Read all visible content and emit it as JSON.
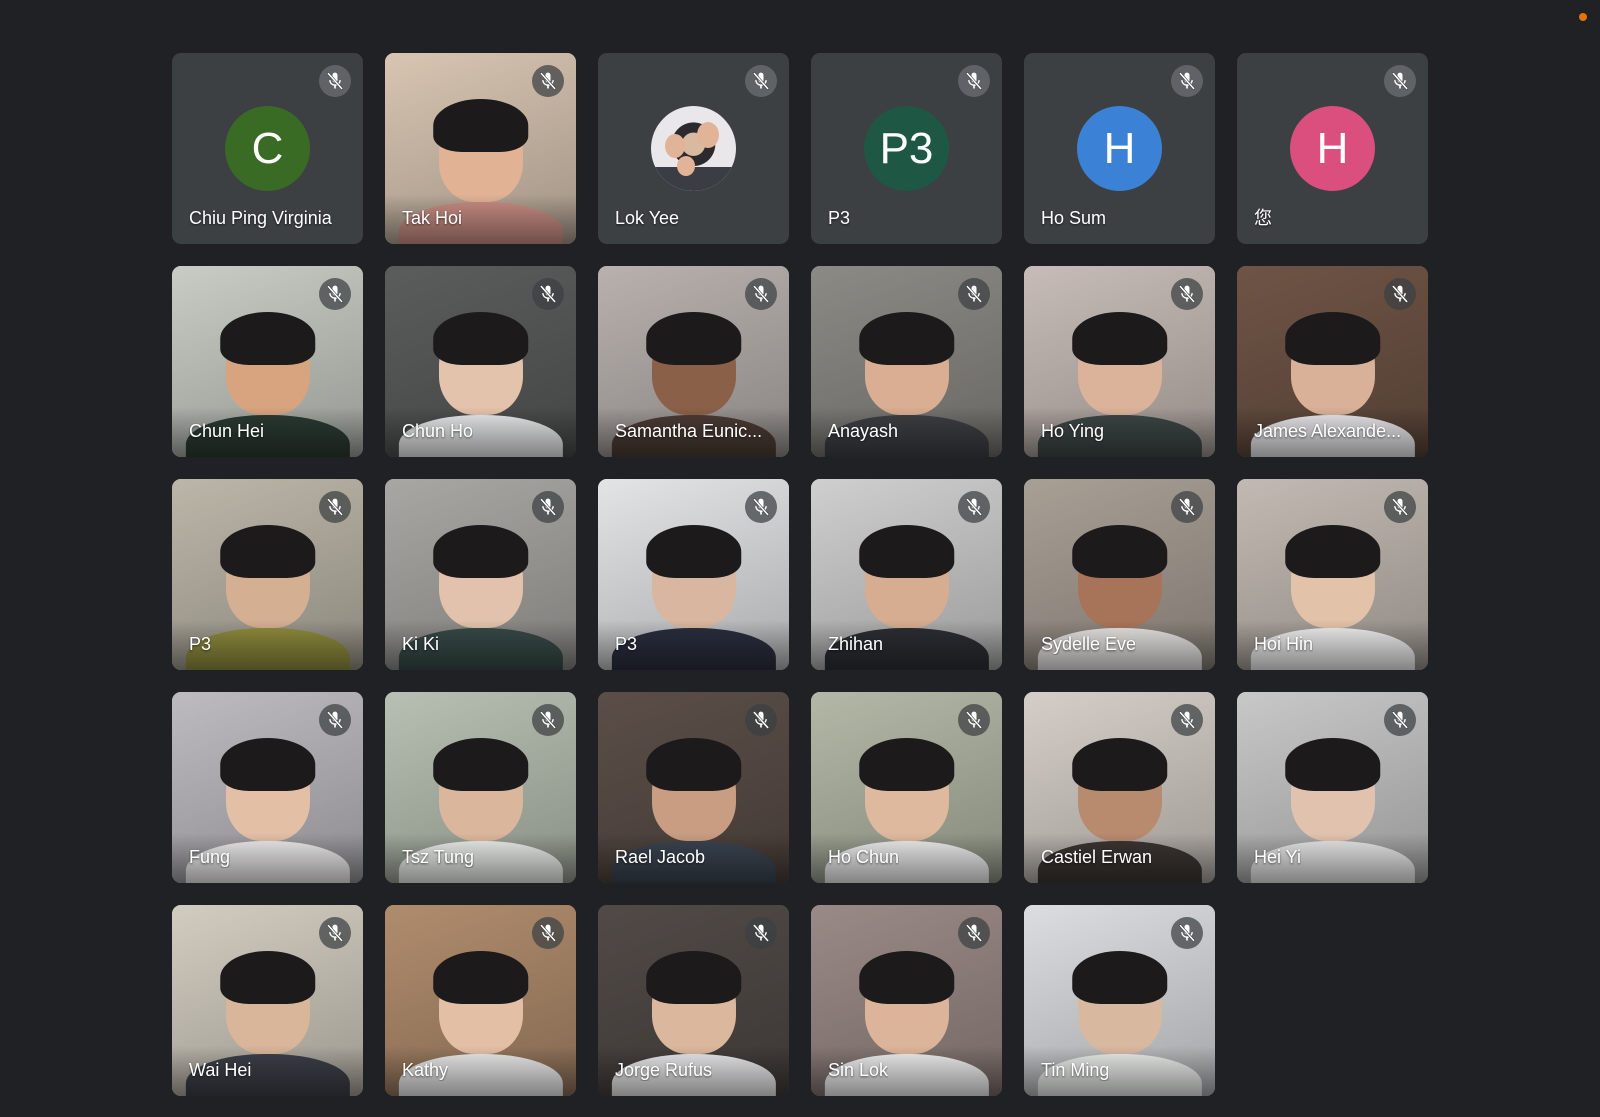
{
  "colors": {
    "background": "#202124",
    "tile": "#3c4043",
    "status_dot": "#e37400"
  },
  "icons": {
    "mic": "mic-off-icon",
    "status": "recording-dot-icon"
  },
  "participants": [
    {
      "name": "Chiu Ping Virginia",
      "muted": true,
      "mode": "avatar",
      "avatar_text": "C",
      "avatar_color": "#3a6b25"
    },
    {
      "name": "Tak Hoi",
      "muted": true,
      "mode": "video",
      "bg": "#d8c5b2",
      "skin": "#e2b295",
      "shirt": "#c98e84"
    },
    {
      "name": "Lok Yee",
      "muted": true,
      "mode": "photo-avatar"
    },
    {
      "name": "P3",
      "muted": true,
      "mode": "avatar",
      "avatar_text": "P3",
      "avatar_color": "#1e5844"
    },
    {
      "name": "Ho Sum",
      "muted": true,
      "mode": "avatar",
      "avatar_text": "H",
      "avatar_color": "#3b82d6"
    },
    {
      "name": "您",
      "muted": true,
      "mode": "avatar",
      "avatar_text": "H",
      "avatar_color": "#db4f7e"
    },
    {
      "name": "Chun Hei",
      "muted": true,
      "mode": "video",
      "bg": "#c7ccc4",
      "skin": "#d7a47f",
      "shirt": "#2b3a32"
    },
    {
      "name": "Chun Ho",
      "muted": true,
      "mode": "video",
      "bg": "#5a5d5c",
      "skin": "#e3c3ab",
      "shirt": "#e8e9ea"
    },
    {
      "name": "Samantha Eunic...",
      "muted": true,
      "mode": "video",
      "bg": "#b8b1ae",
      "skin": "#8a6048",
      "shirt": "#4b3b35"
    },
    {
      "name": "Anayash",
      "muted": true,
      "mode": "video",
      "bg": "#8c8a85",
      "skin": "#d9ae92",
      "shirt": "#3d3f44"
    },
    {
      "name": "Ho Ying",
      "muted": true,
      "mode": "video",
      "bg": "#c7bcb7",
      "skin": "#dbb39b",
      "shirt": "#3d4745"
    },
    {
      "name": "James Alexande...",
      "muted": true,
      "mode": "video",
      "bg": "#6e5445",
      "skin": "#d8b198",
      "shirt": "#e7e7ea"
    },
    {
      "name": "P3",
      "muted": true,
      "mode": "video",
      "bg": "#bcb6a8",
      "skin": "#d5af92",
      "shirt": "#8f8c3d"
    },
    {
      "name": "Ki Ki",
      "muted": true,
      "mode": "video",
      "bg": "#a8a7a3",
      "skin": "#e2c2ac",
      "shirt": "#374a47"
    },
    {
      "name": "P3",
      "muted": true,
      "mode": "video",
      "bg": "#e3e4e6",
      "skin": "#d8b69f",
      "shirt": "#2a2e3e"
    },
    {
      "name": "Zhihan",
      "muted": true,
      "mode": "video",
      "bg": "#cfcfcf",
      "skin": "#d6ad91",
      "shirt": "#2c2e34"
    },
    {
      "name": "Sydelle Eve",
      "muted": true,
      "mode": "video",
      "bg": "#a89f95",
      "skin": "#a87459",
      "shirt": "#e6e4e2"
    },
    {
      "name": "Hoi Hin",
      "muted": true,
      "mode": "video",
      "bg": "#c2bab2",
      "skin": "#e2c2a8",
      "shirt": "#eeeeef"
    },
    {
      "name": "Fung",
      "muted": true,
      "mode": "video",
      "bg": "#bdbbc0",
      "skin": "#e3bfa6",
      "shirt": "#eceaea"
    },
    {
      "name": "Tsz Tung",
      "muted": true,
      "mode": "video",
      "bg": "#b7c0b2",
      "skin": "#dab69c",
      "shirt": "#e9ece8"
    },
    {
      "name": "Rael Jacob",
      "muted": true,
      "mode": "video",
      "bg": "#5b4e48",
      "skin": "#c99d82",
      "shirt": "#3a4450"
    },
    {
      "name": "Ho Chun",
      "muted": true,
      "mode": "video",
      "bg": "#b3b8a6",
      "skin": "#dfb99e",
      "shirt": "#ececec"
    },
    {
      "name": "Castiel Erwan",
      "muted": true,
      "mode": "video",
      "bg": "#d5cec8",
      "skin": "#b88a6e",
      "shirt": "#3b3532"
    },
    {
      "name": "Hei Yi",
      "muted": true,
      "mode": "video",
      "bg": "#c8c8c8",
      "skin": "#e1c2ae",
      "shirt": "#e6e6e6"
    },
    {
      "name": "Wai Hei",
      "muted": true,
      "mode": "video",
      "bg": "#d2ccc0",
      "skin": "#d9b59a",
      "shirt": "#3c3f48"
    },
    {
      "name": "Kathy",
      "muted": true,
      "mode": "video",
      "bg": "#b08c6d",
      "skin": "#e3bfa5",
      "shirt": "#e9e9e9"
    },
    {
      "name": "Jorge Rufus",
      "muted": true,
      "mode": "video",
      "bg": "#514a47",
      "skin": "#dbb79d",
      "shirt": "#e8e8ea"
    },
    {
      "name": "Sin Lok",
      "muted": true,
      "mode": "video",
      "bg": "#9a8a86",
      "skin": "#dcb49a",
      "shirt": "#eeeeee"
    },
    {
      "name": "Tin Ming",
      "muted": true,
      "mode": "video",
      "bg": "#dcdde0",
      "skin": "#d9b8a0",
      "shirt": "#e9ebe9"
    }
  ]
}
